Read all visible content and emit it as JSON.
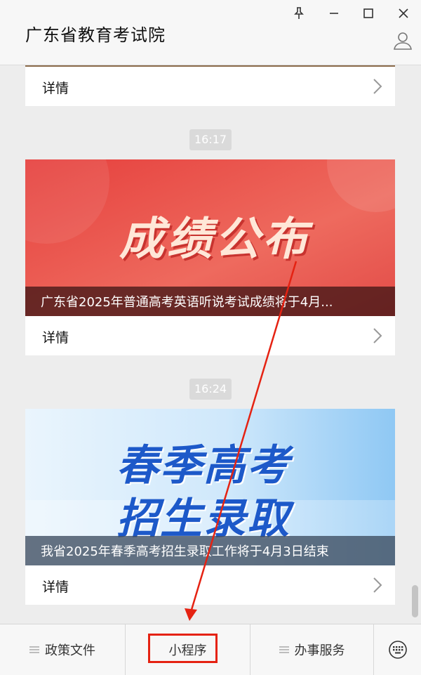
{
  "window": {
    "title": "广东省教育考试院"
  },
  "feed": {
    "items": [
      {
        "detail_label": "详情"
      },
      {
        "time": "16:17",
        "banner_headline": "成绩公布",
        "caption": "广东省2025年普通高考英语听说考试成绩将于4月...",
        "detail_label": "详情"
      },
      {
        "time": "16:24",
        "banner_headline_line1": "春季高考",
        "banner_headline_line2": "招生录取",
        "caption": "我省2025年春季高考招生录取工作将于4月3日结束",
        "detail_label": "详情"
      }
    ]
  },
  "bottom_menu": {
    "items": [
      {
        "label": "政策文件",
        "icon": "menu-lines-icon"
      },
      {
        "label": "小程序"
      },
      {
        "label": "办事服务",
        "icon": "menu-lines-icon"
      }
    ],
    "keyboard_icon": "keyboard-icon"
  },
  "colors": {
    "annotation_red": "#e52212",
    "red_banner": "#e0413f",
    "blue_banner": "#8fc8f4"
  }
}
